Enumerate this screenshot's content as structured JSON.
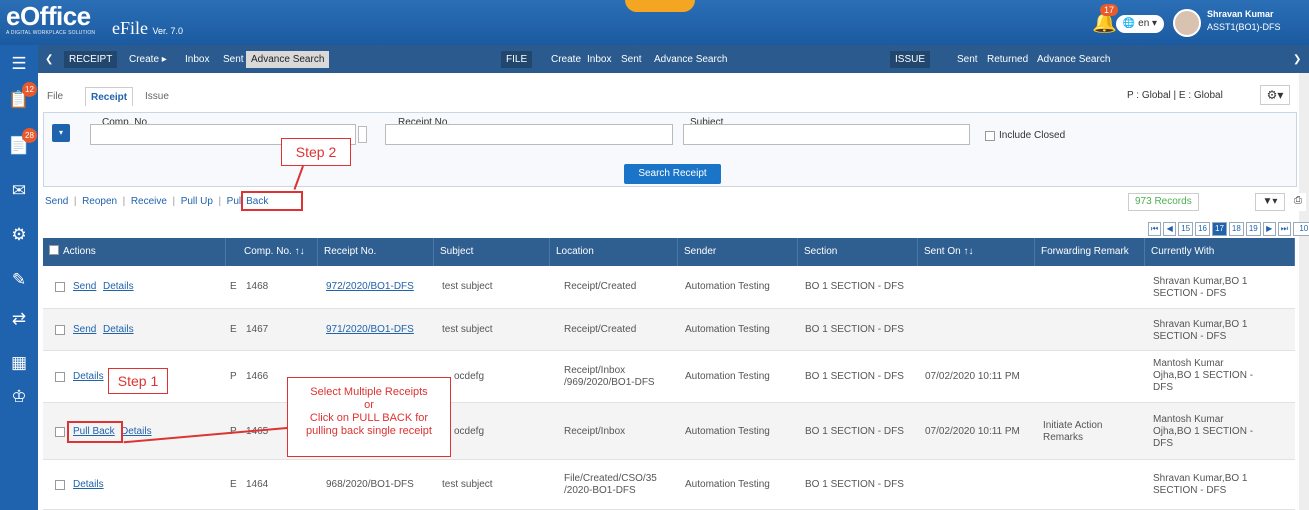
{
  "app": {
    "logo": "eOffice",
    "logo_tagline": "A DIGITAL WORKPLACE SOLUTION",
    "product": "eFile",
    "version": "Ver. 7.0",
    "notifications": "17",
    "lang": "en",
    "user_name": "Shravan Kumar",
    "user_role": "ASST1(BO1)-DFS"
  },
  "sidebar": {
    "receipt_badge": "12",
    "file_badge": "28"
  },
  "menubar": {
    "receipt": {
      "label": "RECEIPT",
      "items": [
        "Create",
        "Inbox",
        "Sent",
        "Advance Search"
      ]
    },
    "file": {
      "label": "FILE",
      "items": [
        "Create",
        "Inbox",
        "Sent",
        "Advance Search"
      ]
    },
    "issue": {
      "label": "ISSUE",
      "items": [
        "Sent",
        "Returned",
        "Advance Search"
      ]
    }
  },
  "tabs": [
    "File",
    "Receipt",
    "Issue"
  ],
  "scope": "P : Global  |  E : Global",
  "search": {
    "comp_no_label": "Comp. No.",
    "receipt_no_label": "Receipt No.",
    "subject_label": "Subject",
    "include_closed": "Include Closed",
    "button": "Search Receipt"
  },
  "actions": [
    "Send",
    "Reopen",
    "Receive",
    "Pull Up",
    "Pull Back"
  ],
  "records": "973 Records",
  "pager": [
    "15",
    "16",
    "17",
    "18",
    "19"
  ],
  "page_size": "10",
  "table": {
    "headers": [
      "Actions",
      "Comp. No. ↑↓",
      "Receipt No.",
      "Subject",
      "Location",
      "Sender",
      "Section",
      "Sent On ↑↓",
      "Forwarding Remark",
      "Currently With"
    ],
    "rows": [
      {
        "act1": "Send",
        "act2": "Details",
        "type": "E",
        "comp": "1468",
        "receipt": "972/2020/BO1-DFS",
        "subject": "test subject",
        "loc1": "Receipt/Created",
        "loc2": "",
        "sender": "Automation Testing",
        "section": "BO 1 SECTION - DFS",
        "sent": "",
        "remark1": "",
        "remark2": "",
        "with1": "Shravan Kumar,BO 1",
        "with2": "SECTION - DFS",
        "with3": ""
      },
      {
        "act1": "Send",
        "act2": "Details",
        "type": "E",
        "comp": "1467",
        "receipt": "971/2020/BO1-DFS",
        "subject": "test subject",
        "loc1": "Receipt/Created",
        "loc2": "",
        "sender": "Automation Testing",
        "section": "BO 1 SECTION - DFS",
        "sent": "",
        "remark1": "",
        "remark2": "",
        "with1": "Shravan Kumar,BO 1",
        "with2": "SECTION - DFS",
        "with3": ""
      },
      {
        "act1": "Details",
        "act2": "",
        "type": "P",
        "comp": "1466",
        "receipt": "",
        "subject": "ocdefg",
        "loc1": "Receipt/Inbox",
        "loc2": "/969/2020/BO1-DFS",
        "sender": "Automation Testing",
        "section": "BO 1 SECTION - DFS",
        "sent": "07/02/2020 10:11 PM",
        "remark1": "",
        "remark2": "",
        "with1": "Mantosh Kumar",
        "with2": "Ojha,BO 1 SECTION -",
        "with3": "DFS"
      },
      {
        "act1": "Pull Back",
        "act2": "Details",
        "type": "P",
        "comp": "1465",
        "receipt": "",
        "subject": "ocdefg",
        "loc1": "Receipt/Inbox",
        "loc2": "",
        "sender": "Automation Testing",
        "section": "BO 1 SECTION - DFS",
        "sent": "07/02/2020 10:11 PM",
        "remark1": "Initiate Action",
        "remark2": "Remarks",
        "with1": "Mantosh Kumar",
        "with2": "Ojha,BO 1 SECTION -",
        "with3": "DFS"
      },
      {
        "act1": "Details",
        "act2": "",
        "type": "E",
        "comp": "1464",
        "receipt": "968/2020/BO1-DFS",
        "subject": "test subject",
        "loc1": "File/Created/CSO/35",
        "loc2": "/2020-BO1-DFS",
        "sender": "Automation Testing",
        "section": "BO 1 SECTION - DFS",
        "sent": "",
        "remark1": "",
        "remark2": "",
        "with1": "Shravan Kumar,BO 1",
        "with2": "SECTION - DFS",
        "with3": ""
      }
    ]
  },
  "annotations": {
    "step1": "Step 1",
    "step2": "Step 2",
    "callout_l1": "Select Multiple Receipts",
    "callout_l2": "or",
    "callout_l3": "Click on PULL BACK for",
    "callout_l4": "pulling back single receipt"
  },
  "colors": {
    "brand": "#1f62ad",
    "menubar": "#2a5a8e",
    "table_header": "#2f5e91",
    "annotation": "#dd3333"
  }
}
